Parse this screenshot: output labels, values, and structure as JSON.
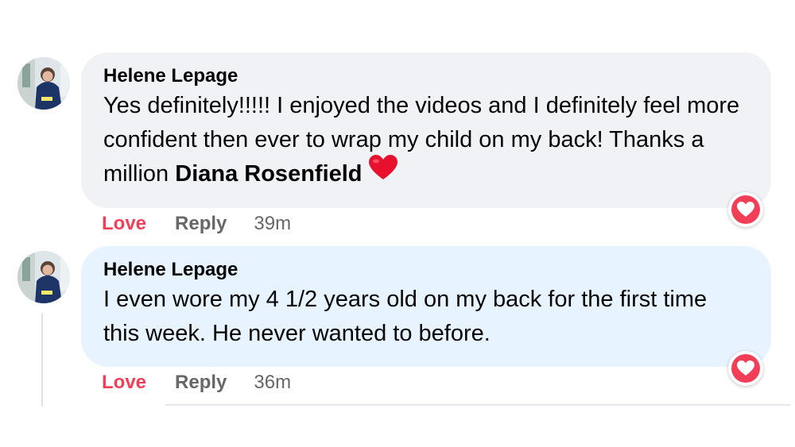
{
  "comments": [
    {
      "author": "Helene Lepage",
      "text_before": "Yes definitely!!!!! I enjoyed the videos and I definitely feel more confident then ever to wrap my child on my back! Thanks a million ",
      "mention": "Diana Rosenfield",
      "emoji": "heart-emoji",
      "reaction": "love",
      "actions": {
        "love": "Love",
        "reply": "Reply"
      },
      "timestamp": "39m",
      "bubble_color": "#f0f2f5"
    },
    {
      "author": "Helene Lepage",
      "text": "I even wore my 4 1/2 years old on my back for the first time this week. He never wanted to before.",
      "reaction": "love",
      "actions": {
        "love": "Love",
        "reply": "Reply"
      },
      "timestamp": "36m",
      "bubble_color": "#e7f3ff"
    }
  ],
  "colors": {
    "love_red": "#f33e58",
    "secondary_text": "#65676b",
    "primary_text": "#050505"
  }
}
